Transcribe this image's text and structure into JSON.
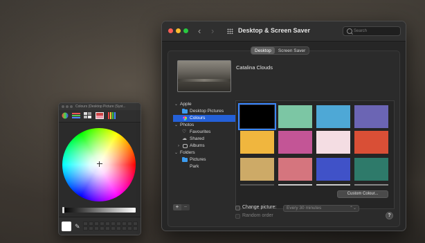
{
  "colours_panel": {
    "title": "Colours (Desktop Picture (Syst...",
    "toolbar_icons": [
      "color-wheel-icon",
      "color-sliders-icon",
      "color-palettes-icon",
      "image-palettes-icon",
      "pencils-icon"
    ]
  },
  "window": {
    "title": "Desktop & Screen Saver",
    "search_placeholder": "Search",
    "tabs": [
      {
        "label": "Desktop",
        "active": true
      },
      {
        "label": "Screen Saver",
        "active": false
      }
    ],
    "current_picture_name": "Catalina Clouds"
  },
  "source_list": [
    {
      "label": "Apple",
      "type": "group"
    },
    {
      "label": "Desktop Pictures",
      "type": "folder"
    },
    {
      "label": "Colours",
      "type": "colours",
      "selected": true
    },
    {
      "label": "Photos",
      "type": "group"
    },
    {
      "label": "Favourites",
      "type": "heart"
    },
    {
      "label": "Shared",
      "type": "cloud"
    },
    {
      "label": "Albums",
      "type": "albums"
    },
    {
      "label": "Folders",
      "type": "group"
    },
    {
      "label": "Pictures",
      "type": "folder"
    },
    {
      "label": "Park",
      "type": "plain"
    }
  ],
  "colour_tiles": [
    "#000000",
    "#7cc6a4",
    "#4ea8d6",
    "#6b65b4",
    "#f0b63e",
    "#c35596",
    "#f4dde3",
    "#d94f36",
    "#cdaa67",
    "#d5757e",
    "#4052c8",
    "#2e7a6a"
  ],
  "custom_colour_label": "Custom Colour...",
  "change_picture_label": "Change picture:",
  "change_picture_interval": "Every 30 minutes",
  "random_order_label": "Random order",
  "add_label": "+",
  "remove_label": "−",
  "help_label": "?"
}
